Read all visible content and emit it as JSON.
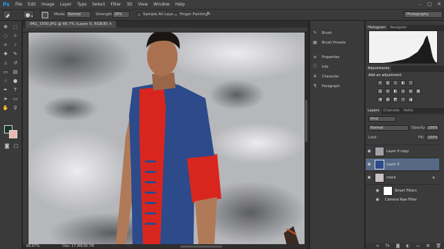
{
  "app": {
    "logo": "Ps"
  },
  "menu": [
    "File",
    "Edit",
    "Image",
    "Layer",
    "Type",
    "Select",
    "Filter",
    "3D",
    "View",
    "Window",
    "Help"
  ],
  "window_controls": [
    "–",
    "□",
    "✕"
  ],
  "options": {
    "mode_label": "Mode:",
    "mode_value": "Normal",
    "strength_label": "Strength:",
    "strength_value": "26%",
    "sample_all_layers": "Sample All Layers",
    "finger_painting": "Finger Painting",
    "workspace": "Photography"
  },
  "document": {
    "tab_title": "IMG_1500.JPG @ 66.7% (Layer 0, RGB/8) ×",
    "zoom": "66.67%",
    "doc_size": "Doc: 17.9M/30.7M"
  },
  "dock": [
    {
      "icon": "brush-icon",
      "glyph": "✎",
      "label": "Brush"
    },
    {
      "icon": "brush-presets-icon",
      "glyph": "▦",
      "label": "Brush Presets"
    },
    {
      "icon": "properties-icon",
      "glyph": "≡",
      "label": "Properties"
    },
    {
      "icon": "info-icon",
      "glyph": "ⓘ",
      "label": "Info"
    },
    {
      "icon": "character-icon",
      "glyph": "A",
      "label": "Character"
    },
    {
      "icon": "paragraph-icon",
      "glyph": "¶",
      "label": "Paragraph"
    }
  ],
  "histogram_tabs": [
    "Histogram",
    "Navigator"
  ],
  "adjustments": {
    "tab": "Adjustments",
    "title": "Add an adjustment"
  },
  "layers_tabs": [
    "Layers",
    "Channels",
    "Paths"
  ],
  "layers_panel": {
    "kind": "Kind",
    "blend_mode": "Normal",
    "opacity_label": "Opacity:",
    "opacity_value": "100%",
    "lock_label": "Lock:",
    "fill_label": "Fill:",
    "fill_value": "100%"
  },
  "layers": [
    {
      "name": "Layer 0 copy",
      "selected": false
    },
    {
      "name": "Layer 0",
      "selected": true
    },
    {
      "name": "crack",
      "selected": false
    },
    {
      "name": "Smart Filters",
      "selected": false
    },
    {
      "name": "Camera Raw Filter",
      "selected": false
    }
  ],
  "colors": {
    "accent": "#2aa3ff",
    "foreground": "#17342a",
    "background": "#e9b7b2",
    "selected_layer": "#566a86",
    "shirt": "#2d4a8a",
    "sleeve": "#d8261f"
  }
}
